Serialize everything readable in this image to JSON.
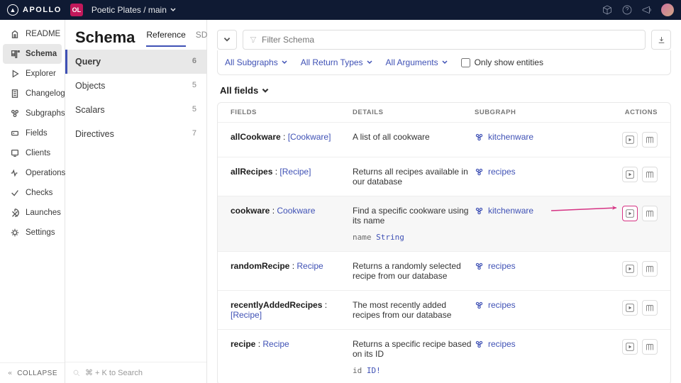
{
  "topbar": {
    "brand": "APOLLO",
    "org": "OL",
    "graph": "Poetic Plates / main"
  },
  "sidebar": {
    "items": [
      {
        "label": "README"
      },
      {
        "label": "Schema"
      },
      {
        "label": "Explorer"
      },
      {
        "label": "Changelog"
      },
      {
        "label": "Subgraphs"
      },
      {
        "label": "Fields"
      },
      {
        "label": "Clients"
      },
      {
        "label": "Operations"
      },
      {
        "label": "Checks"
      },
      {
        "label": "Launches"
      },
      {
        "label": "Settings"
      }
    ],
    "active_index": 1,
    "collapse": "COLLAPSE"
  },
  "page": {
    "title": "Schema",
    "tabs": [
      "Reference",
      "SDL"
    ],
    "active_tab": 0,
    "types": [
      {
        "label": "Query",
        "count": 6
      },
      {
        "label": "Objects",
        "count": 5
      },
      {
        "label": "Scalars",
        "count": 5
      },
      {
        "label": "Directives",
        "count": 7
      }
    ],
    "active_type": 0,
    "search_hint": "⌘ + K to Search"
  },
  "filter": {
    "placeholder": "Filter Schema",
    "subgraphs": "All Subgraphs",
    "return_types": "All Return Types",
    "arguments": "All Arguments",
    "entities_label": "Only show entities"
  },
  "section": {
    "title": "All fields",
    "headers": {
      "fields": "FIELDS",
      "details": "DETAILS",
      "subgraph": "SUBGRAPH",
      "actions": "ACTIONS"
    }
  },
  "rows": [
    {
      "name": "allCookware",
      "type": "[Cookware]",
      "desc": "A list of all cookware",
      "sub": "kitchenware",
      "args": []
    },
    {
      "name": "allRecipes",
      "type": "[Recipe]",
      "desc": "Returns all recipes available in our database",
      "sub": "recipes",
      "args": []
    },
    {
      "name": "cookware",
      "type": "Cookware",
      "desc": "Find a specific cookware using its name",
      "sub": "kitchenware",
      "args": [
        {
          "n": "name",
          "t": "String"
        }
      ],
      "hover": true,
      "hl_play": true
    },
    {
      "name": "randomRecipe",
      "type": "Recipe",
      "desc": "Returns a randomly selected recipe from our database",
      "sub": "recipes",
      "args": []
    },
    {
      "name": "recentlyAddedRecipes",
      "type": "[Recipe]",
      "desc": "The most recently added recipes from our database",
      "sub": "recipes",
      "args": []
    },
    {
      "name": "recipe",
      "type": "Recipe",
      "desc": "Returns a specific recipe based on its ID",
      "sub": "recipes",
      "args": [
        {
          "n": "id",
          "t": "ID!"
        }
      ]
    }
  ]
}
